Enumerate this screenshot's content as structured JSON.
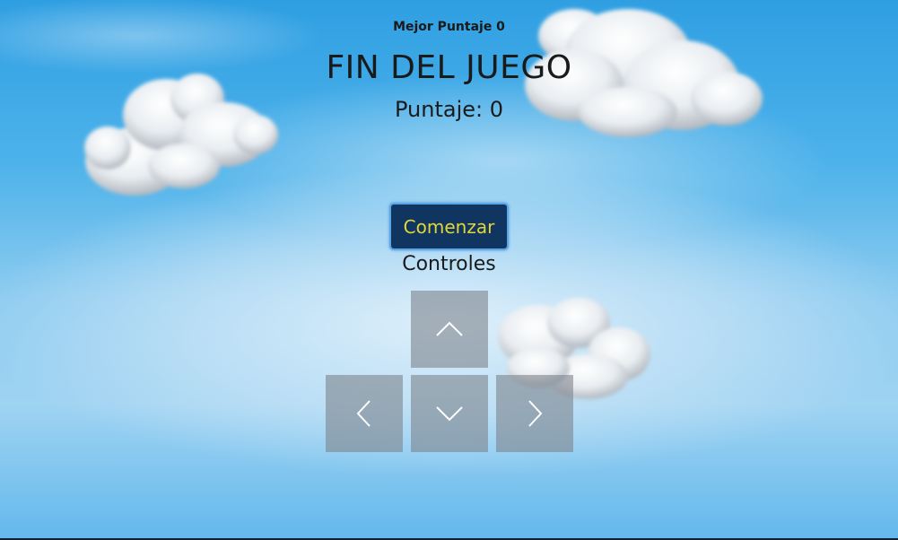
{
  "hud": {
    "best_score_text": "Mejor Puntaje 0",
    "title": "FIN DEL JUEGO",
    "score_text": "Puntaje: 0"
  },
  "menu": {
    "start_label": "Comenzar",
    "controls_label": "Controles"
  },
  "controls": {
    "up": "chevron-up-icon",
    "left": "chevron-left-icon",
    "down": "chevron-down-icon",
    "right": "chevron-right-icon"
  },
  "colors": {
    "sky_top": "#2f9fe2",
    "sky_mid": "#9fd3f2",
    "button_bg": "#0f3560",
    "button_text": "#e3d636",
    "button_border": "#5aa6e8",
    "control_bg": "#7d848c"
  }
}
